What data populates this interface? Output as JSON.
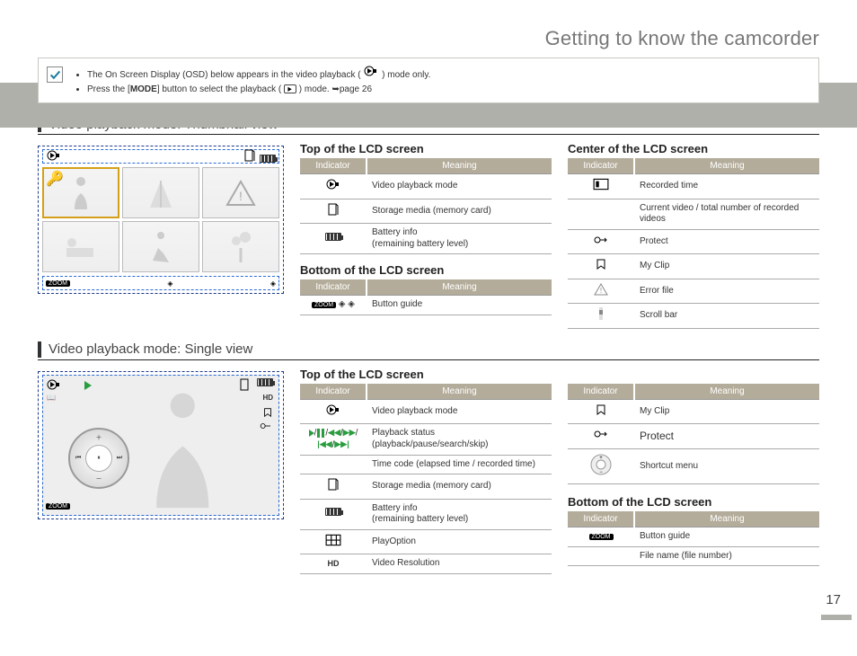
{
  "page": {
    "title": "Getting to know the camcorder",
    "number": "17"
  },
  "notes": {
    "item1_a": "The On Screen Display (OSD) below appears in the video playback (",
    "item1_b": ") mode only.",
    "item2_a": "Press the [",
    "item2_mode": "MODE",
    "item2_b": "] button to select the playback (",
    "item2_c": ") mode. ",
    "item2_link": "page 26"
  },
  "section1": {
    "heading": "Video playback mode: Thumbnail view"
  },
  "thumbTop": {
    "heading": "Top of the LCD screen",
    "th_ind": "Indicator",
    "th_mean": "Meaning",
    "rows": [
      {
        "meaning": "Video playback mode"
      },
      {
        "meaning": "Storage media (memory card)"
      },
      {
        "meaning": "Battery info\n(remaining battery level)"
      }
    ]
  },
  "thumbBottom": {
    "heading": "Bottom of the LCD screen",
    "th_ind": "Indicator",
    "th_mean": "Meaning",
    "rows": [
      {
        "meaning": "Button guide"
      }
    ]
  },
  "thumbCenter": {
    "heading": "Center of the LCD screen",
    "th_ind": "Indicator",
    "th_mean": "Meaning",
    "rows": [
      {
        "meaning": "Recorded time"
      },
      {
        "meaning": "Current video / total number of recorded videos"
      },
      {
        "meaning": "Protect"
      },
      {
        "meaning": "My Clip"
      },
      {
        "meaning": "Error file"
      },
      {
        "meaning": "Scroll bar"
      }
    ]
  },
  "section2": {
    "heading": "Video playback mode: Single view"
  },
  "singleTopLeft": {
    "heading": "Top of the LCD screen",
    "th_ind": "Indicator",
    "th_mean": "Meaning",
    "rows": [
      {
        "meaning": "Video playback mode"
      },
      {
        "meaning": "Playback status (playback/pause/search/skip)"
      },
      {
        "meaning": "Time code (elapsed time / recorded time)"
      },
      {
        "meaning": "Storage media (memory card)"
      },
      {
        "meaning": "Battery info\n(remaining battery level)"
      },
      {
        "meaning": "PlayOption"
      },
      {
        "meaning": "Video Resolution"
      }
    ]
  },
  "singleTopRight": {
    "th_ind": "Indicator",
    "th_mean": "Meaning",
    "rows": [
      {
        "meaning": "My Clip"
      },
      {
        "meaning": "Protect"
      },
      {
        "meaning": "Shortcut menu"
      }
    ]
  },
  "singleBottom": {
    "heading": "Bottom of the LCD screen",
    "th_ind": "Indicator",
    "th_mean": "Meaning",
    "rows": [
      {
        "meaning": "Button guide"
      },
      {
        "meaning": "File name (file number)"
      }
    ]
  },
  "lcd": {
    "zoom": "ZOOM",
    "hd": "HD"
  }
}
